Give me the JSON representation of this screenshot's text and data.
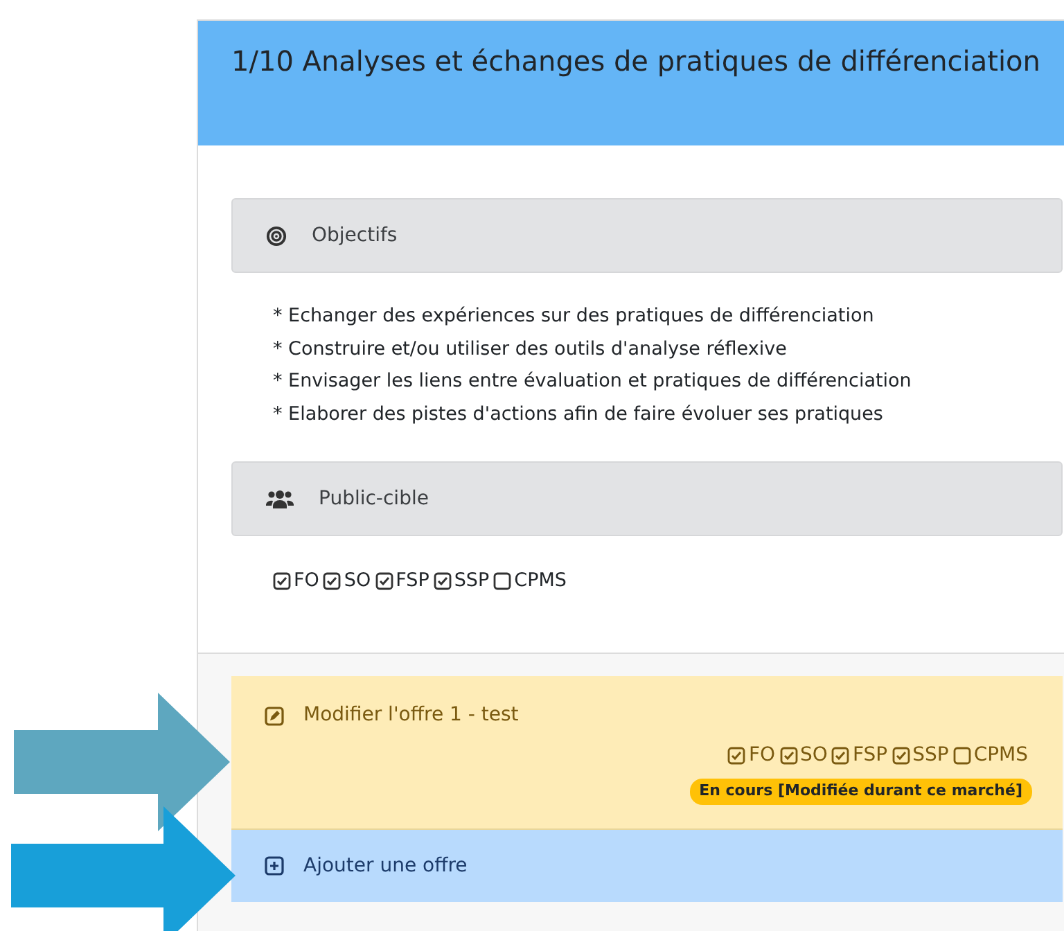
{
  "card": {
    "title": "1/10 Analyses et échanges de pratiques de différenciation"
  },
  "sections": [
    {
      "kind": "objectives",
      "heading": "Objectifs",
      "lines": [
        "* Echanger des expériences sur des pratiques de différenciation",
        "* Construire et/ou utiliser des outils d'analyse réflexive",
        "* Envisager les liens entre évaluation et pratiques de différenciation",
        "* Elaborer des pistes d'actions afin de faire évoluer ses pratiques"
      ]
    },
    {
      "kind": "audience",
      "heading": "Public-cible",
      "targets": [
        {
          "label": "FO",
          "checked": true
        },
        {
          "label": "SO",
          "checked": true
        },
        {
          "label": "FSP",
          "checked": true
        },
        {
          "label": "SSP",
          "checked": true
        },
        {
          "label": "CPMS",
          "checked": false
        }
      ]
    }
  ],
  "offers": [
    {
      "kind": "edit",
      "label": "Modifier l'offre 1 - test",
      "targets": [
        {
          "label": "FO",
          "checked": true
        },
        {
          "label": "SO",
          "checked": true
        },
        {
          "label": "FSP",
          "checked": true
        },
        {
          "label": "SSP",
          "checked": true
        },
        {
          "label": "CPMS",
          "checked": false
        }
      ],
      "status": "En cours [Modifiée durant ce marché]"
    },
    {
      "kind": "add",
      "label": "Ajouter une offre"
    }
  ],
  "arrows": [
    {
      "color": "#5ea7bf"
    },
    {
      "color": "#189fd9"
    }
  ]
}
